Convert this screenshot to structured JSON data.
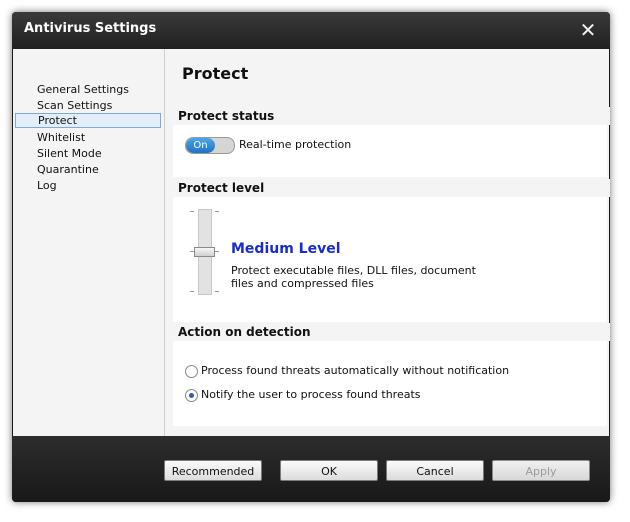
{
  "window": {
    "title": "Antivirus Settings"
  },
  "sidebar": {
    "items": [
      {
        "label": "General Settings"
      },
      {
        "label": "Scan Settings"
      },
      {
        "label": "Protect"
      },
      {
        "label": "Whitelist"
      },
      {
        "label": "Silent Mode"
      },
      {
        "label": "Quarantine"
      },
      {
        "label": "Log"
      }
    ],
    "selected": "Protect"
  },
  "main": {
    "title": "Protect",
    "protect_status": {
      "header": "Protect status",
      "toggle_label": "On",
      "toggle_state": "on",
      "description": "Real-time protection"
    },
    "protect_level": {
      "header": "Protect level",
      "level_name": "Medium Level",
      "level_description": "Protect executable files, DLL files, document files and compressed files"
    },
    "action": {
      "header": "Action on detection",
      "options": [
        {
          "label": "Process found threats automatically without notification",
          "checked": false
        },
        {
          "label": "Notify the user to process found threats",
          "checked": true
        }
      ]
    }
  },
  "footer": {
    "recommended": "Recommended",
    "ok": "OK",
    "cancel": "Cancel",
    "apply": "Apply"
  },
  "colors": {
    "level_text": "#1a2bd0",
    "toggle_on": "#1f73c4",
    "selection_bg": "#e3eefb"
  },
  "icons": {
    "close": "close-icon"
  }
}
